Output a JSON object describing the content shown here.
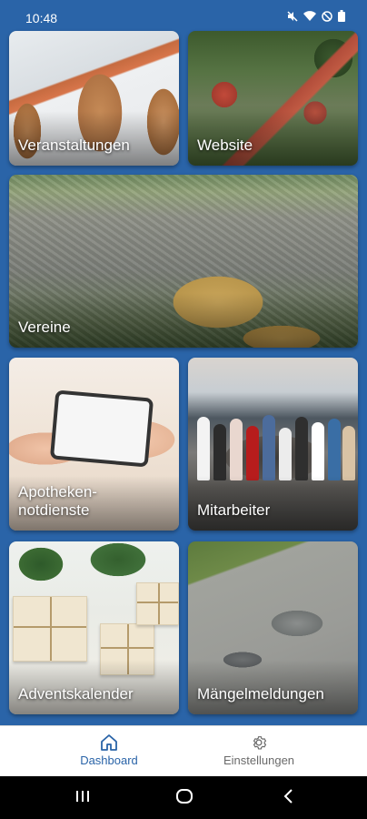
{
  "status": {
    "time": "10:48",
    "icons": [
      "mute-icon",
      "wifi-icon",
      "dnd-icon",
      "battery-icon"
    ]
  },
  "tiles": [
    {
      "label": "Veranstaltungen",
      "icon": "event-photo"
    },
    {
      "label": "Website",
      "icon": "village-photo"
    },
    {
      "label": "Vereine",
      "icon": "aerial-town-photo"
    },
    {
      "label": "Apotheken-notdienste",
      "icon": "pharmacy-photo"
    },
    {
      "label": "Mitarbeiter",
      "icon": "staff-photo"
    },
    {
      "label": "Adventskalender",
      "icon": "gifts-photo"
    },
    {
      "label": "Mängelmeldungen",
      "icon": "road-damage-photo"
    }
  ],
  "bottom_nav": {
    "items": [
      {
        "label": "Dashboard",
        "icon": "home-icon",
        "active": true
      },
      {
        "label": "Einstellungen",
        "icon": "gear-icon",
        "active": false
      }
    ]
  },
  "colors": {
    "background": "#2a64a8",
    "accent": "#2a64a8",
    "nav_inactive": "#6a6a6a"
  }
}
